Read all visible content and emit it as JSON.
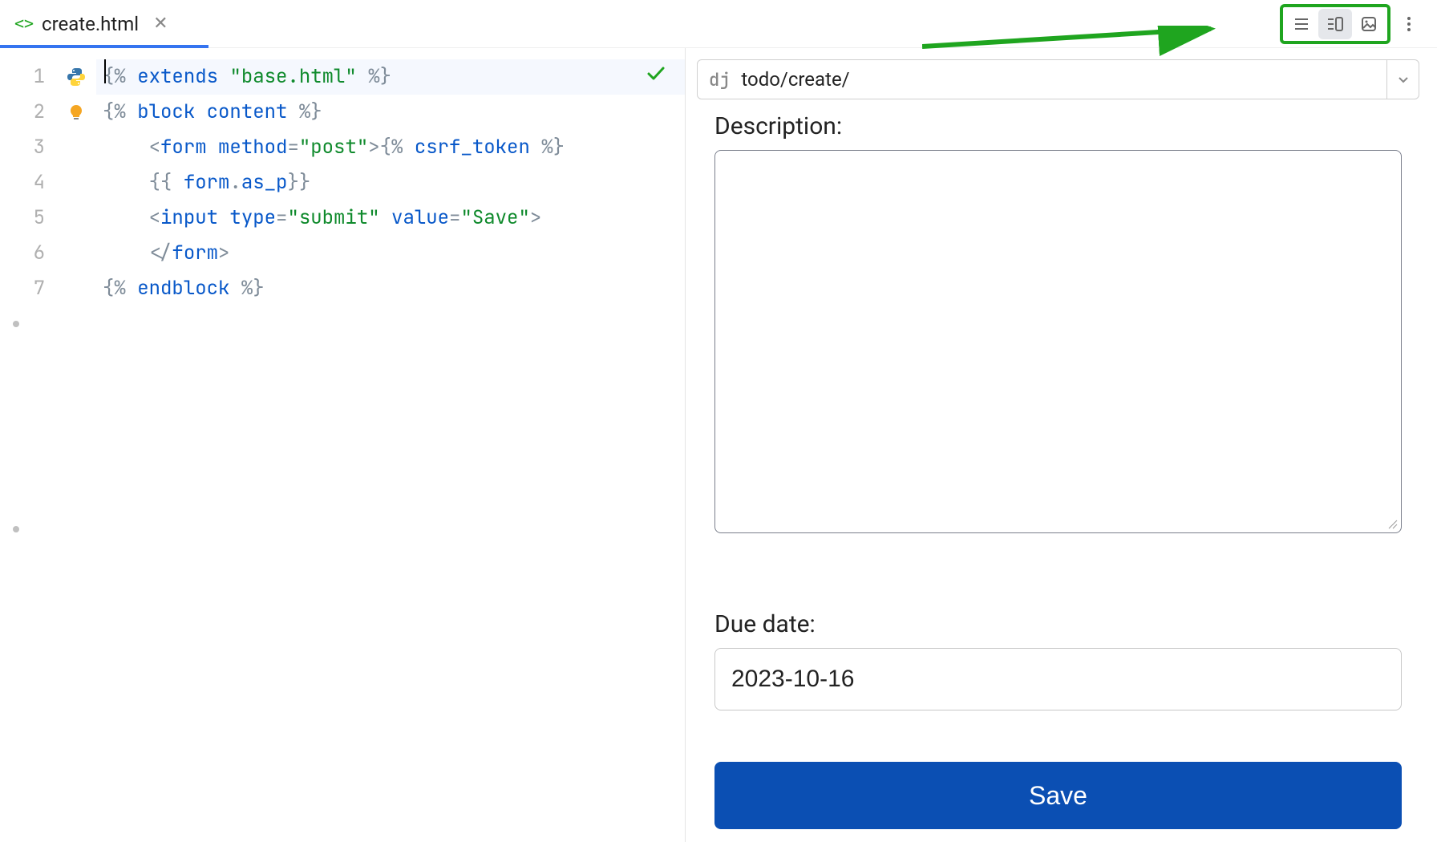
{
  "tab": {
    "filename": "create.html"
  },
  "toolbar": {
    "view_mode": "split"
  },
  "editor": {
    "lines": [
      {
        "n": "1",
        "indent": 0,
        "highlight": true,
        "icon": "python"
      },
      {
        "n": "2",
        "indent": 0,
        "icon": "bulb"
      },
      {
        "n": "3",
        "indent": 2
      },
      {
        "n": "4",
        "indent": 2
      },
      {
        "n": "5",
        "indent": 2
      },
      {
        "n": "6",
        "indent": 2
      },
      {
        "n": "7",
        "indent": 0
      }
    ],
    "tokens": {
      "l1_extends": "extends",
      "l1_base": "\"base.html\"",
      "l2_block": "block",
      "l2_content": "content",
      "l3_form": "form",
      "l3_method": "method",
      "l3_post": "\"post\"",
      "l3_csrf": "csrf_token",
      "l4_form": "form",
      "l4_asp": "as_p",
      "l5_input": "input",
      "l5_type": "type",
      "l5_submit": "\"submit\"",
      "l5_value": "value",
      "l5_save": "\"Save\"",
      "l6_form": "form",
      "l7_endblock": "endblock"
    }
  },
  "preview": {
    "url_prefix": "dj",
    "url": "todo/create/",
    "description_label": "Description:",
    "description_value": "",
    "due_date_label": "Due date:",
    "due_date_value": "2023-10-16",
    "save_button": "Save"
  }
}
